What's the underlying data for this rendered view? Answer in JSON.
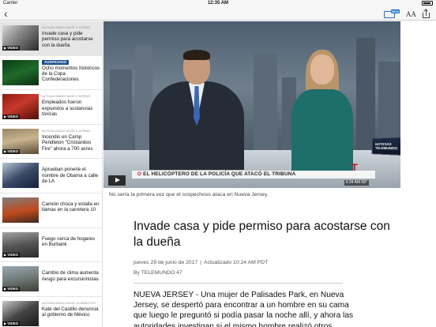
{
  "status_bar": {
    "carrier": "Carrier",
    "time": "12:35 AM"
  },
  "nav": {
    "back_icon": "chevron-left-icon",
    "live_badge": "NEW",
    "text_size_label": "AA"
  },
  "sidebar": {
    "items": [
      {
        "meta": "ACTUALIZADO HACE 3 HORAS",
        "title": "Invade casa y pide permiso para acostarse con la dueña",
        "video": "VIDEO",
        "active": true
      },
      {
        "badge": "AUSPICIADO",
        "title": "Ocho momentos históricos de la Copa Confederaciones"
      },
      {
        "meta": "ACTUALIZADO HACE 3 HORAS",
        "title": "Empleados fueron expuestos a sustancias tóxicas",
        "video": "VIDEO"
      },
      {
        "meta": "ACTUALIZADO HACE 3 HORAS",
        "title": "Incendio en Camp Pendleton \"Cristianitos Fire\" ahora a 700 acres",
        "video": "VIDEO"
      },
      {
        "title": "Aprueban ponerle el nombre de Obama a calle de LA"
      },
      {
        "title": "Camión choca y estalla en llamas en la carretera 10"
      },
      {
        "title": "Fuego cerca de hogares en Burbank",
        "video": "VIDEO"
      },
      {
        "title": "Cambio de clima aumenta riesgo para excursionistas",
        "video": "VIDEO"
      },
      {
        "meta": "ACTUALIZADO HACE 13 MINUTOS",
        "title": "Kate del Castillo denuncia al gobierno de México",
        "video": "VIDEO"
      }
    ]
  },
  "video": {
    "ticker": "EL HELICÓPTERO DE LA POLICÍA QUE ATACÓ EL TRIBUNA",
    "clock": "6:34 AM 68°",
    "logo": "T",
    "promo": "NOTICIAS TELEMUNDO"
  },
  "article": {
    "caption": "No sería la primera vez que el sospechoso ataca en Nueva Jersey.",
    "headline": "Invade casa y pide permiso para acostarse con la dueña",
    "date": "jueves 29 de junio de 2017",
    "updated": "Actualizado 10:24 AM PDT",
    "byline": "By TELEMUNDO 47",
    "body": "NUEVA JERSEY - Una mujer de Palisades Park, en Nueva Jersey, se despertó para encontrar a un hombre en su cama que luego le preguntó si podía pasar la noche allí, y ahora las autoridades investigan si el mismo hombre realizó otros acosos"
  }
}
